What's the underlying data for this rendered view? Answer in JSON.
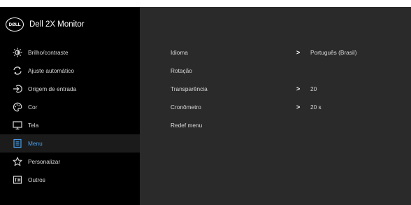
{
  "header": {
    "logo_text": "DØLL",
    "title": "Dell 2X Monitor"
  },
  "menu": {
    "items": [
      {
        "label": "Brilho/contraste",
        "icon": "brightness-icon"
      },
      {
        "label": "Ajuste automático",
        "icon": "auto-adjust-icon"
      },
      {
        "label": "Origem de entrada",
        "icon": "input-source-icon"
      },
      {
        "label": "Cor",
        "icon": "color-palette-icon"
      },
      {
        "label": "Tela",
        "icon": "display-icon"
      },
      {
        "label": "Menu",
        "icon": "menu-list-icon",
        "selected": true
      },
      {
        "label": "Personalizar",
        "icon": "star-icon"
      },
      {
        "label": "Outros",
        "icon": "others-icon"
      }
    ]
  },
  "submenu": {
    "rows": [
      {
        "label": "Idioma",
        "has_arrow": true,
        "value": "Português (Brasil)"
      },
      {
        "label": "Rotação",
        "has_arrow": false,
        "value": ""
      },
      {
        "label": "Transparência",
        "has_arrow": true,
        "value": "20"
      },
      {
        "label": "Cronômetro",
        "has_arrow": true,
        "value": "20 s"
      },
      {
        "label": "Redef menu",
        "has_arrow": false,
        "value": ""
      }
    ]
  },
  "colors": {
    "left_panel": "#000000",
    "right_panel": "#2a2a2a",
    "selected_accent": "#4a9ee8",
    "text": "#d8d8d8"
  }
}
